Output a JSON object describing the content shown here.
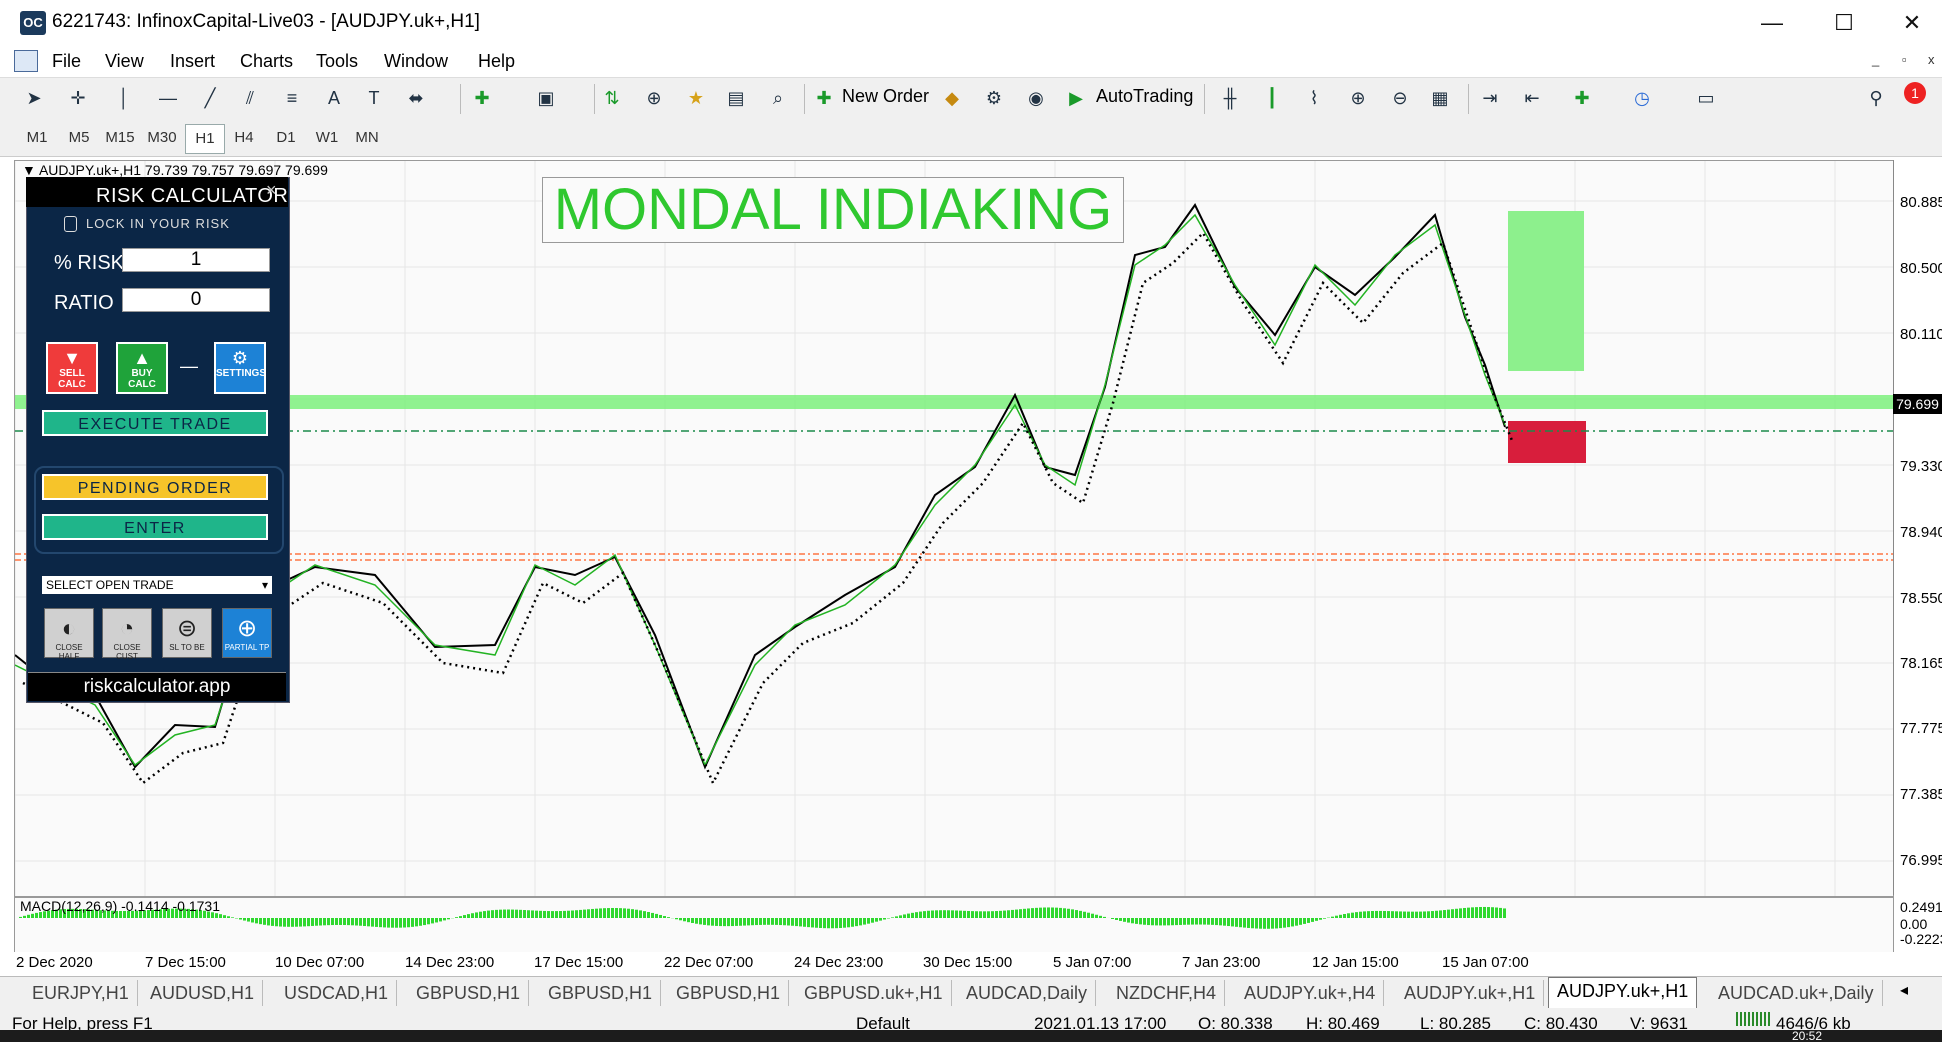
{
  "window": {
    "title": "6221743: InfinoxCapital-Live03 - [AUDJPY.uk+,H1]",
    "app_logo": "OC",
    "minimize": "—",
    "maximize": "☐",
    "close": "✕"
  },
  "menu": {
    "items": [
      "File",
      "View",
      "Insert",
      "Charts",
      "Tools",
      "Window",
      "Help"
    ],
    "mdi_minimize": "_",
    "mdi_restore": "▫",
    "mdi_close": "x"
  },
  "toolbar": {
    "new_order_label": "New Order",
    "autotrading_label": "AutoTrading",
    "alert_count": "1"
  },
  "timeframes": {
    "items": [
      "M1",
      "M5",
      "M15",
      "M30",
      "H1",
      "H4",
      "D1",
      "W1",
      "MN"
    ],
    "active": "H1"
  },
  "chart": {
    "symbol_info": "▼ AUDJPY.uk+,H1  79.739 79.757 79.697 79.699",
    "watermark": "MONDAL INDIAKING",
    "current_price": "79.699",
    "price_ticks": [
      "80.885",
      "80.500",
      "80.110",
      "79.330",
      "78.940",
      "78.550",
      "78.165",
      "77.775",
      "77.385",
      "76.995"
    ],
    "time_ticks": [
      "2 Dec 2020",
      "7 Dec 15:00",
      "10 Dec 07:00",
      "14 Dec 23:00",
      "17 Dec 15:00",
      "22 Dec 07:00",
      "24 Dec 23:00",
      "30 Dec 15:00",
      "5 Jan 07:00",
      "7 Jan 23:00",
      "12 Jan 15:00",
      "15 Jan 07:00"
    ],
    "colors": {
      "price_line": "#000000",
      "ma_green": "#23b323",
      "tp_box": "#8df08d",
      "sl_box": "#d81e3c",
      "entry_band": "#7cf07c",
      "orange_line": "#ff5a1e"
    }
  },
  "macd": {
    "label": "MACD(12,26,9) -0.1414 -0.1731",
    "ticks": [
      "0.2491",
      "0.00",
      "-0.2223"
    ]
  },
  "risk_calculator": {
    "title": "RISK CALCULATOR",
    "close": "×",
    "lock_text": "LOCK IN YOUR RISK",
    "risk_label": "% RISK",
    "risk_value": "1",
    "ratio_label": "RATIO",
    "ratio_value": "0",
    "sell_calc": "SELL CALC",
    "buy_calc": "BUY CALC",
    "settings": "SETTINGS",
    "dash": "—",
    "execute_trade": "EXECUTE TRADE",
    "pending_order": "PENDING ORDER",
    "enter": "ENTER",
    "select_trade": "SELECT OPEN TRADE",
    "close_half": "CLOSE HALF",
    "close_cust": "CLOSE CUST",
    "sl_to_be": "SL TO BE",
    "partial_tp": "PARTIAL TP",
    "footer": "riskcalculator.app",
    "colors": {
      "panel_bg": "#0b2646",
      "sell_red": "#ef3b3b",
      "buy_green": "#1fa33a",
      "settings_blue": "#1d82d6",
      "execute_teal": "#1fb58a",
      "pending_yellow": "#f6c42a"
    }
  },
  "chart_tabs": {
    "items": [
      "EURJPY,H1",
      "AUDUSD,H1",
      "USDCAD,H1",
      "GBPUSD,H1",
      "GBPUSD,H1",
      "GBPUSD,H1",
      "GBPUSD.uk+,H1",
      "AUDCAD,Daily",
      "NZDCHF,H4",
      "AUDJPY.uk+,H4",
      "AUDJPY.uk+,H1",
      "AUDJPY.uk+,H1",
      "AUDCAD.uk+,Daily"
    ],
    "active_index": 11
  },
  "status": {
    "help": "For Help, press F1",
    "profile": "Default",
    "datetime": "2021.01.13 17:00",
    "open": "O: 80.338",
    "high": "H: 80.469",
    "low": "L: 80.285",
    "close": "C: 80.430",
    "volume": "V: 9631",
    "traffic": "4646/6 kb",
    "clock": "20:52"
  }
}
